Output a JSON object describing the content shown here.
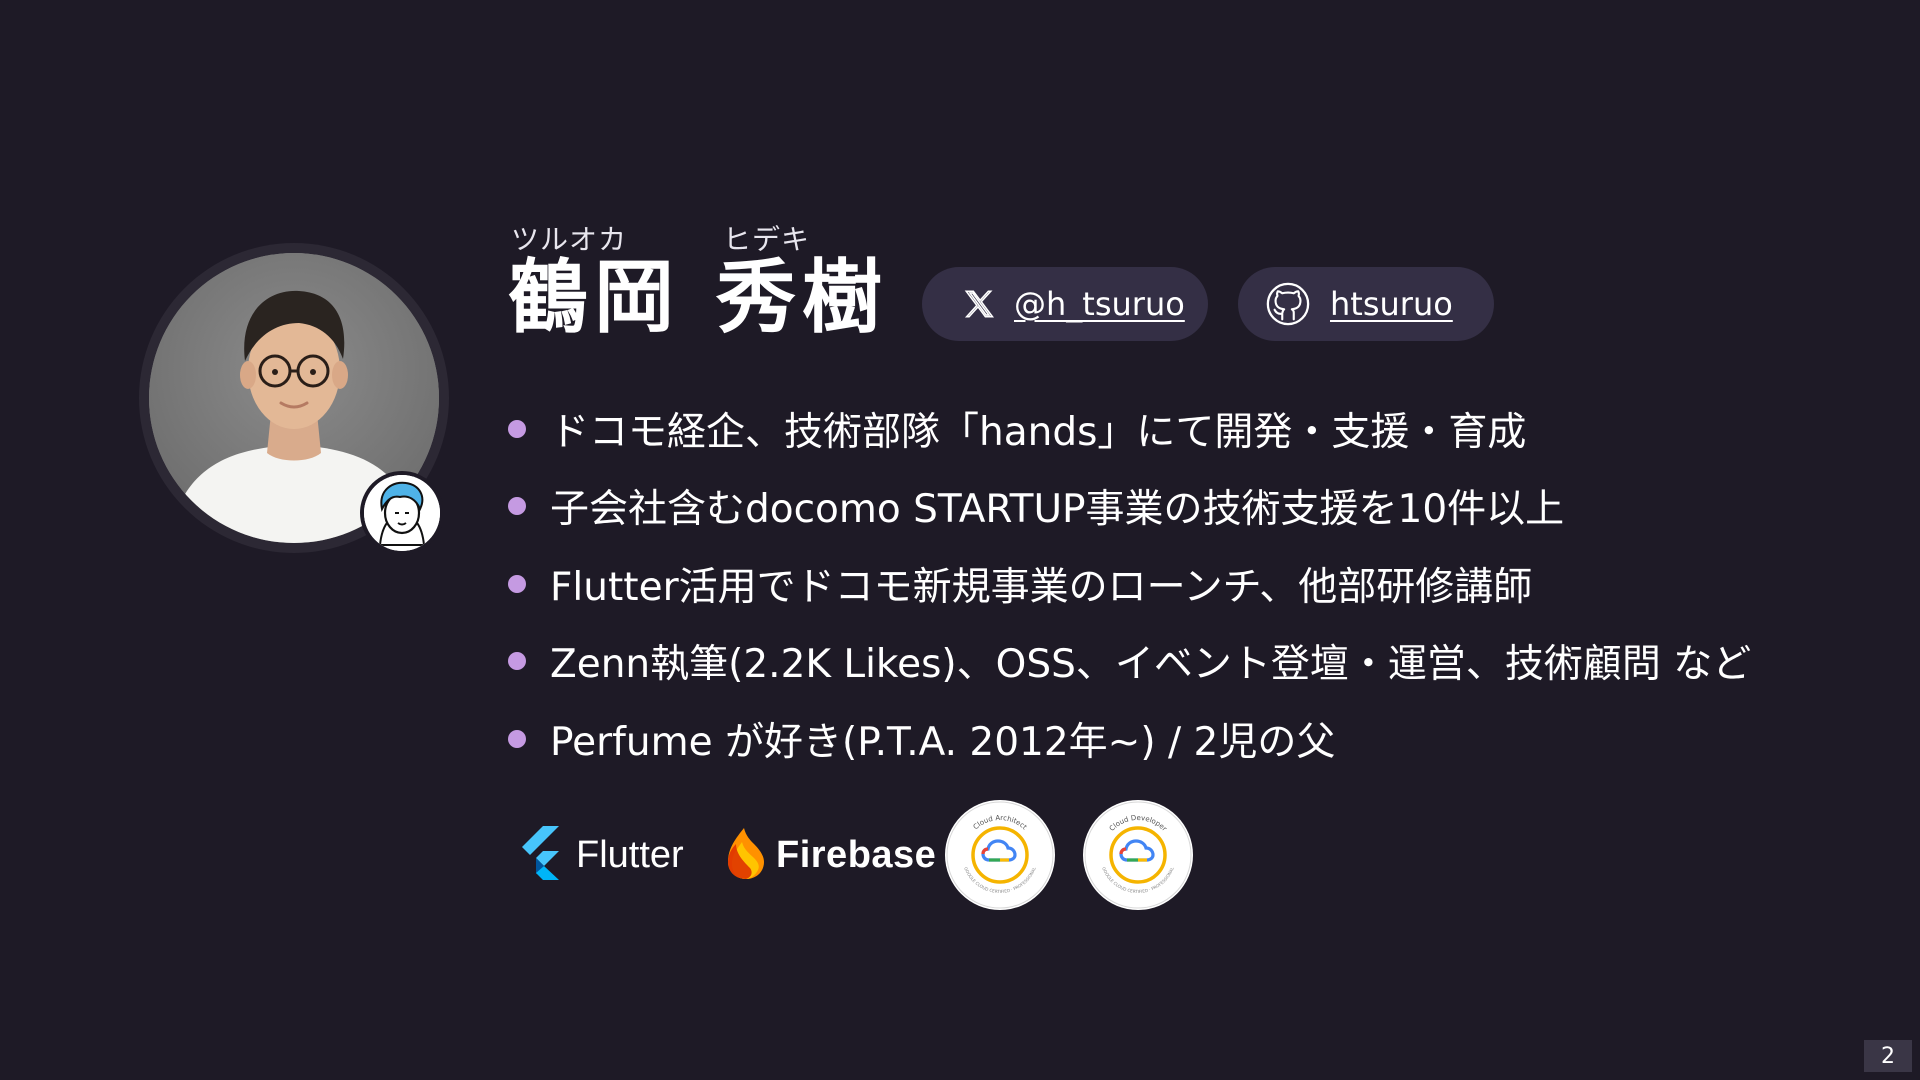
{
  "profile": {
    "ruby_family": "ツルオカ",
    "ruby_given": "ヒデキ",
    "name_family": "鶴岡",
    "name_given": "秀樹"
  },
  "social": {
    "x_handle": "@h_tsuruo",
    "github_handle": "htsuruo",
    "x_icon": "x-logo-icon",
    "github_icon": "github-logo-icon"
  },
  "bullets": [
    "ドコモ経企、技術部隊「hands」にて開発・支援・育成",
    "子会社含むdocomo STARTUP事業の技術支援を10件以上",
    "Flutter活用でドコモ新規事業のローンチ、他部研修講師",
    "Zenn執筆(2.2K Likes)、OSS、イベント登壇・運営、技術顧問 など",
    "Perfume が好き(P.T.A. 2012年~) / 2児の父"
  ],
  "logos": {
    "flutter": "Flutter",
    "firebase": "Firebase",
    "badge_architect": "Cloud Architect",
    "badge_developer": "Cloud Developer",
    "badge_ring": "GOOGLE CLOUD CERTIFIED · PROFESSIONAL"
  },
  "page": {
    "number": "2"
  },
  "colors": {
    "background": "#1e1a26",
    "chip": "#342f45",
    "bullet_dot": "#c59ae2",
    "text": "#ffffff"
  }
}
